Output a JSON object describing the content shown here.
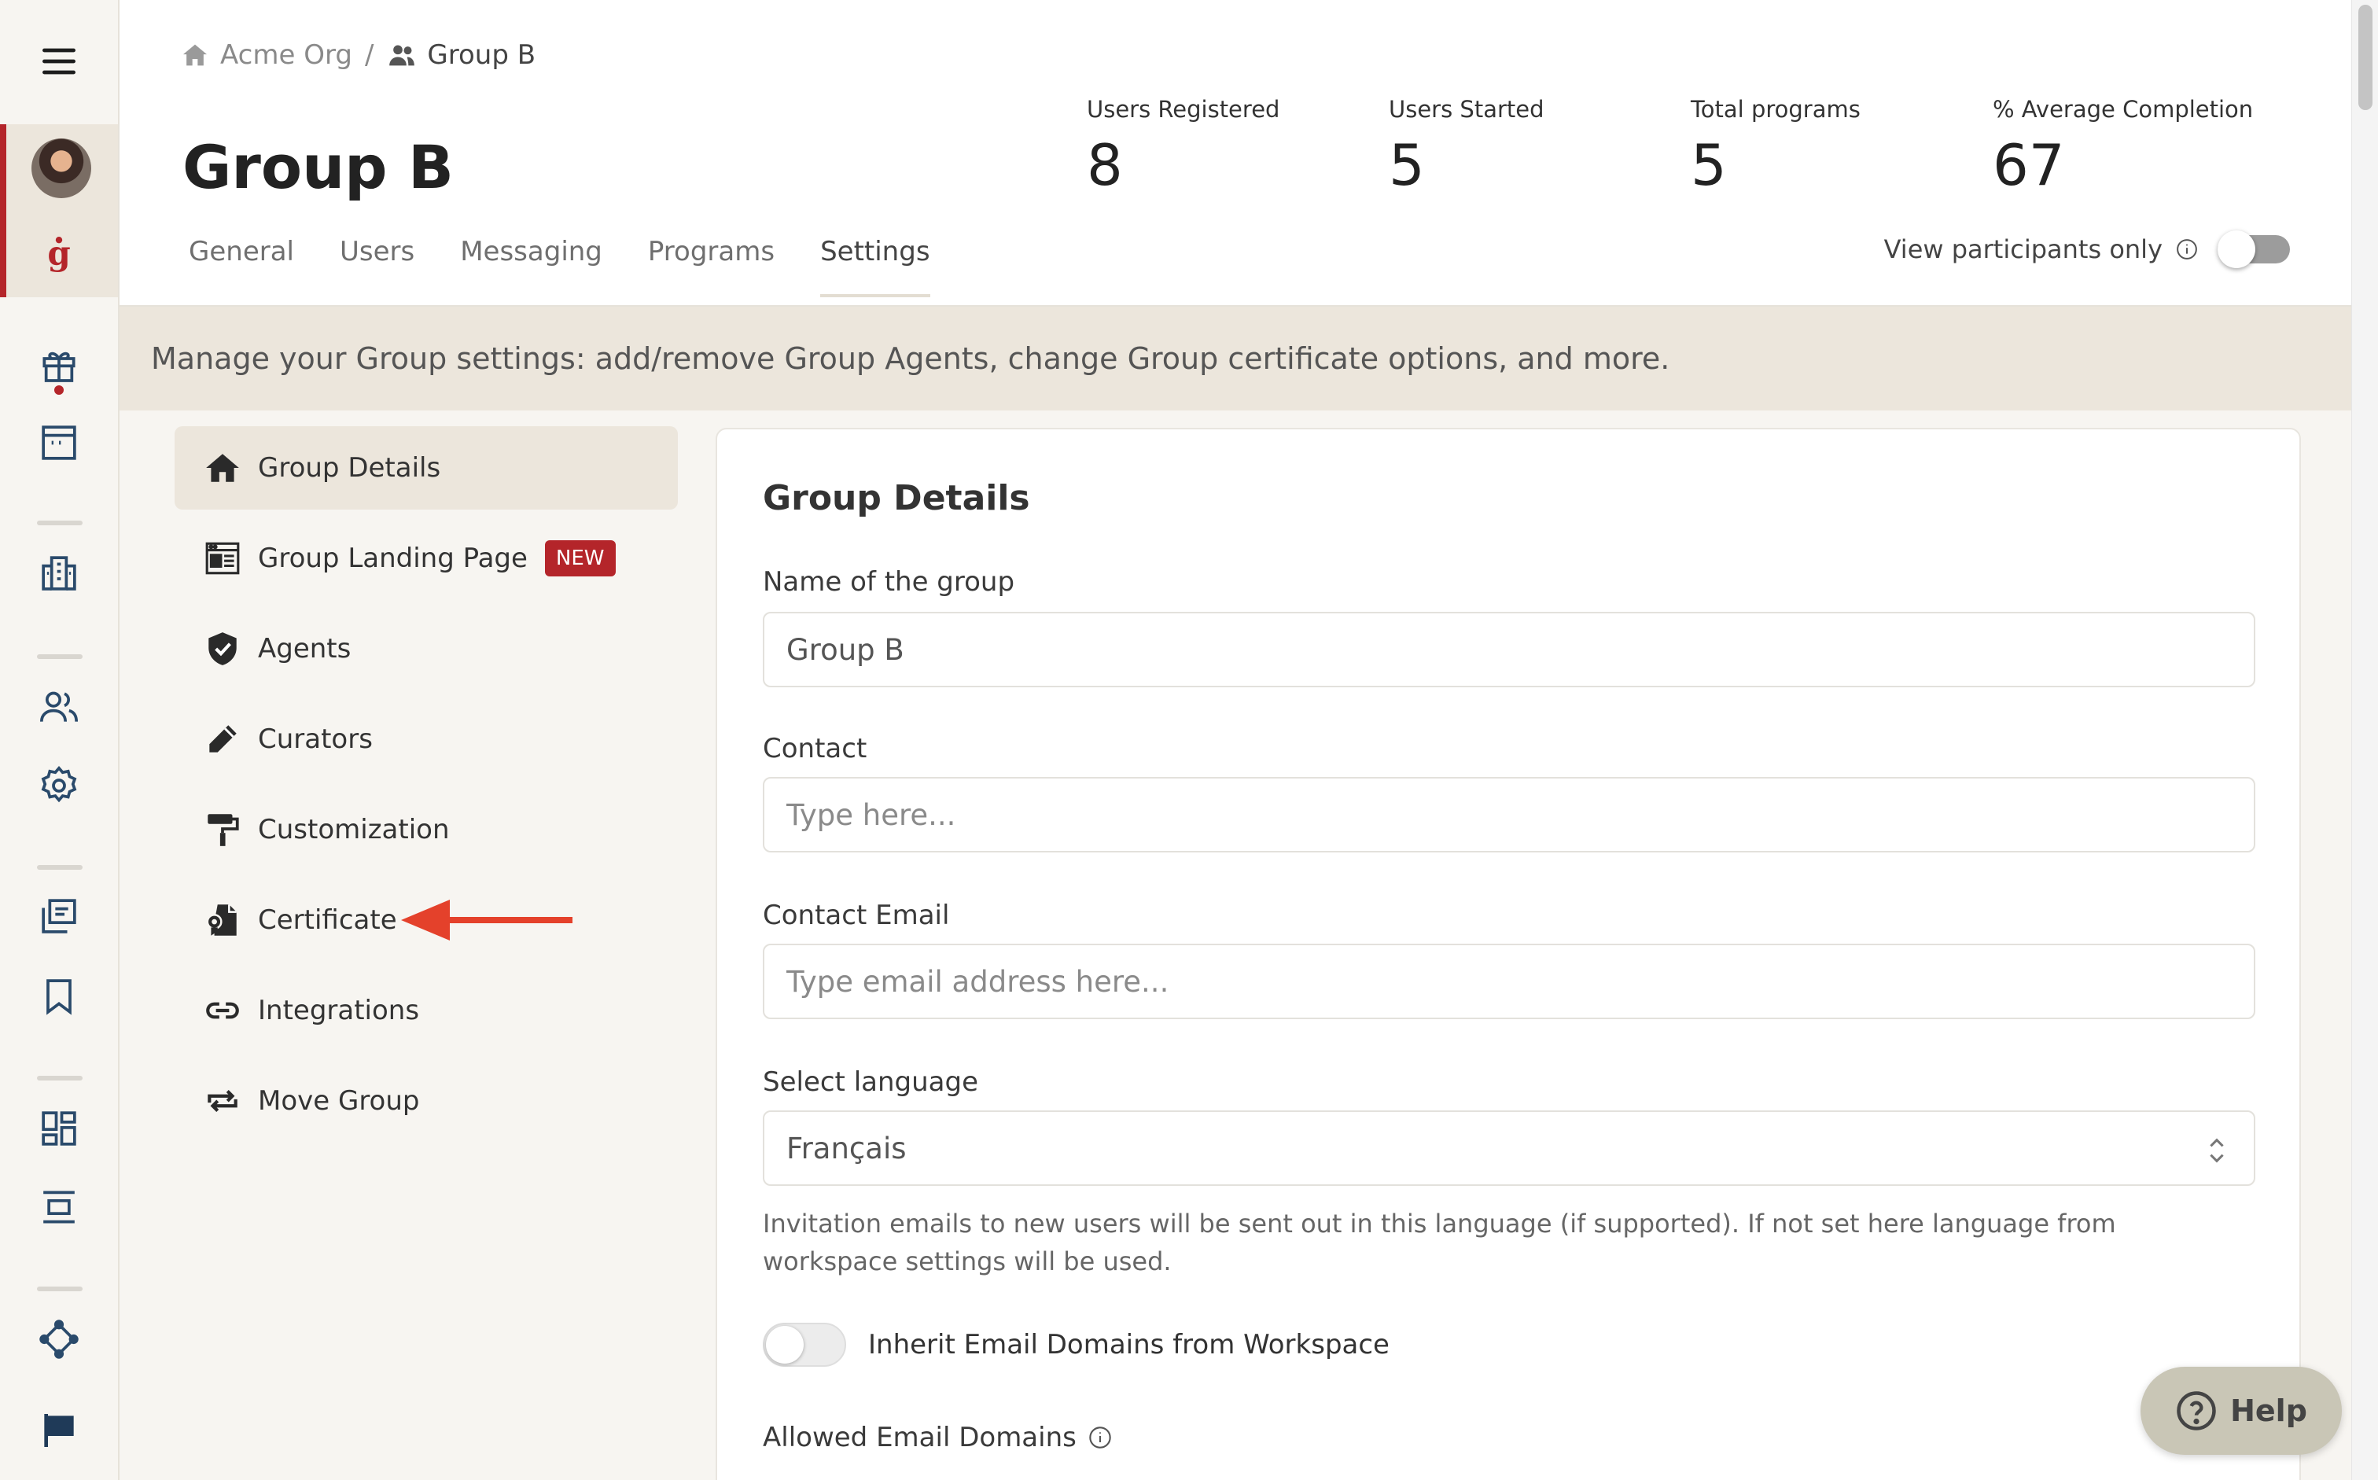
{
  "breadcrumb": {
    "org": "Acme Org",
    "separator": "/",
    "group": "Group B"
  },
  "page_title": "Group B",
  "stats": [
    {
      "label": "Users Registered",
      "value": "8"
    },
    {
      "label": "Users Started",
      "value": "5"
    },
    {
      "label": "Total programs",
      "value": "5"
    },
    {
      "label": "% Average Completion",
      "value": "67"
    }
  ],
  "tabs": [
    {
      "label": "General"
    },
    {
      "label": "Users"
    },
    {
      "label": "Messaging"
    },
    {
      "label": "Programs"
    },
    {
      "label": "Settings",
      "active": true
    }
  ],
  "view_participants": {
    "label": "View participants only",
    "on": false
  },
  "banner": "Manage your Group settings: add/remove Group Agents, change Group certificate options, and more.",
  "subnav": [
    {
      "label": "Group Details",
      "icon": "home-icon",
      "active": true
    },
    {
      "label": "Group Landing Page",
      "icon": "landing-page-icon",
      "badge": "NEW"
    },
    {
      "label": "Agents",
      "icon": "shield-check-icon"
    },
    {
      "label": "Curators",
      "icon": "pencil-icon"
    },
    {
      "label": "Customization",
      "icon": "paint-roller-icon"
    },
    {
      "label": "Certificate",
      "icon": "certificate-icon"
    },
    {
      "label": "Integrations",
      "icon": "link-icon"
    },
    {
      "label": "Move Group",
      "icon": "swap-arrows-icon"
    }
  ],
  "form": {
    "title": "Group Details",
    "name": {
      "label": "Name of the group",
      "value": "Group B"
    },
    "contact": {
      "label": "Contact",
      "placeholder": "Type here..."
    },
    "contact_email": {
      "label": "Contact Email",
      "placeholder": "Type email address here..."
    },
    "language": {
      "label": "Select language",
      "value": "Français"
    },
    "language_help": "Invitation emails to new users will be sent out in this language (if supported). If not set here language from workspace settings will be used.",
    "inherit_domains": {
      "label": "Inherit Email Domains from Workspace",
      "on": false
    },
    "allowed_domains": {
      "label": "Allowed Email Domains"
    }
  },
  "help_button": {
    "label": "Help"
  },
  "colors": {
    "accent_red": "#b4252a",
    "banner_bg": "#ece6dc",
    "help_bg": "#c9c6b6",
    "arrow": "#e4412b"
  }
}
